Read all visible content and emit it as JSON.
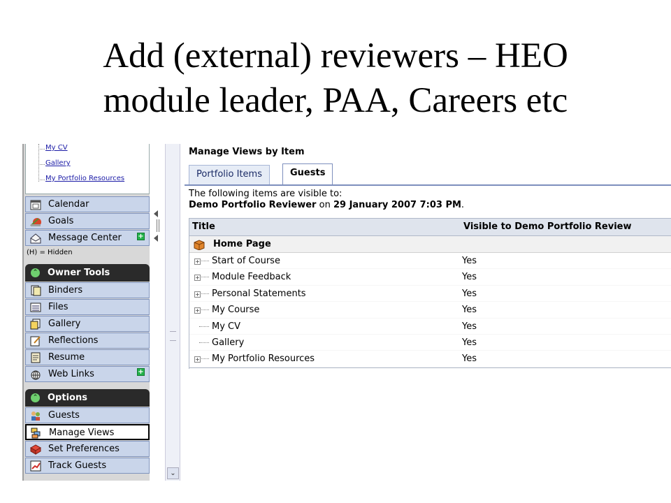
{
  "slide": {
    "title_line1": "Add (external) reviewers – HEO",
    "title_line2": "module leader, PAA, Careers etc"
  },
  "sidebar": {
    "tree_links": [
      "My CV",
      "Gallery",
      "My Portfolio Resources"
    ],
    "top_items": [
      {
        "label": "Calendar",
        "icon": "calendar-icon"
      },
      {
        "label": "Goals",
        "icon": "goals-icon"
      },
      {
        "label": "Message Center",
        "icon": "envelope-icon",
        "has_add": true
      }
    ],
    "hidden_note": "(H) = Hidden",
    "owner_tools": {
      "header": "Owner Tools",
      "items": [
        {
          "label": "Binders",
          "icon": "binders-icon"
        },
        {
          "label": "Files",
          "icon": "files-icon"
        },
        {
          "label": "Gallery",
          "icon": "gallery-icon"
        },
        {
          "label": "Reflections",
          "icon": "reflections-icon"
        },
        {
          "label": "Resume",
          "icon": "resume-icon"
        },
        {
          "label": "Web Links",
          "icon": "globe-icon",
          "has_add": true
        }
      ]
    },
    "options": {
      "header": "Options",
      "items": [
        {
          "label": "Guests",
          "icon": "guests-icon"
        },
        {
          "label": "Manage Views",
          "icon": "manage-views-icon",
          "selected": true
        },
        {
          "label": "Set Preferences",
          "icon": "preferences-icon"
        },
        {
          "label": "Track Guests",
          "icon": "track-guests-icon"
        }
      ]
    }
  },
  "main": {
    "heading": "Manage Views by Item",
    "tabs": [
      {
        "label": "Portfolio Items",
        "active": false
      },
      {
        "label": "Guests",
        "active": true
      }
    ],
    "visible_to_intro": "The following items are visible to:",
    "reviewer_name": "Demo Portfolio Reviewer",
    "on_word": "on",
    "visible_date": "29 January 2007 7:03 PM",
    "period": ".",
    "table": {
      "col_title": "Title",
      "col_visible": "Visible to Demo Portfolio Review",
      "group_label": "Home Page",
      "rows": [
        {
          "title": "Start of Course",
          "visible": "Yes",
          "expandable": true
        },
        {
          "title": "Module Feedback",
          "visible": "Yes",
          "expandable": true
        },
        {
          "title": "Personal Statements",
          "visible": "Yes",
          "expandable": true
        },
        {
          "title": "My Course",
          "visible": "Yes",
          "expandable": true
        },
        {
          "title": "My CV",
          "visible": "Yes",
          "expandable": false
        },
        {
          "title": "Gallery",
          "visible": "Yes",
          "expandable": false
        },
        {
          "title": "My Portfolio Resources",
          "visible": "Yes",
          "expandable": true
        }
      ]
    }
  },
  "colors": {
    "nav_item_bg": "#c9d5ea",
    "section_header_bg": "#2a2a2a",
    "grid_header_bg": "#dfe4ed",
    "add_badge": "#23b24b"
  }
}
